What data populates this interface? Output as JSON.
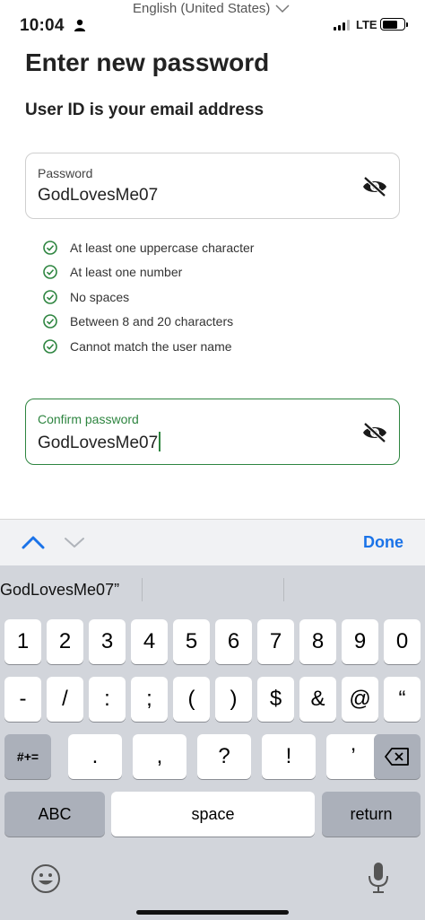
{
  "status_bar": {
    "time": "10:04",
    "network": "LTE",
    "language": "English (United States)"
  },
  "page": {
    "title": "Enter new password",
    "subtitle": "User ID is your email address"
  },
  "password_field": {
    "label": "Password",
    "value": "GodLovesMe07",
    "toggle_icon": "eye-slash-icon"
  },
  "rules": [
    {
      "label": "At least one uppercase character",
      "met": true
    },
    {
      "label": "At least one number",
      "met": true
    },
    {
      "label": "No spaces",
      "met": true
    },
    {
      "label": "Between 8 and 20 characters",
      "met": true
    },
    {
      "label": "Cannot match the user name",
      "met": true
    }
  ],
  "confirm_field": {
    "label": "Confirm password",
    "value": "GodLovesMe07",
    "toggle_icon": "eye-slash-icon"
  },
  "accessory_bar": {
    "done_label": "Done"
  },
  "keyboard": {
    "suggestion": "GodLovesMe07”",
    "row1": [
      "1",
      "2",
      "3",
      "4",
      "5",
      "6",
      "7",
      "8",
      "9",
      "0"
    ],
    "row2": [
      "-",
      "/",
      ":",
      ";",
      "(",
      ")",
      "$",
      "&",
      "@",
      "“"
    ],
    "row3": [
      ".",
      ",",
      "?",
      "!",
      "’"
    ],
    "symbols_label": "#+=",
    "abc_label": "ABC",
    "space_label": "space",
    "return_label": "return"
  },
  "colors": {
    "accent_green": "#2e8540",
    "done_blue": "#1a73e8",
    "keyboard_bg": "#d2d5db"
  }
}
